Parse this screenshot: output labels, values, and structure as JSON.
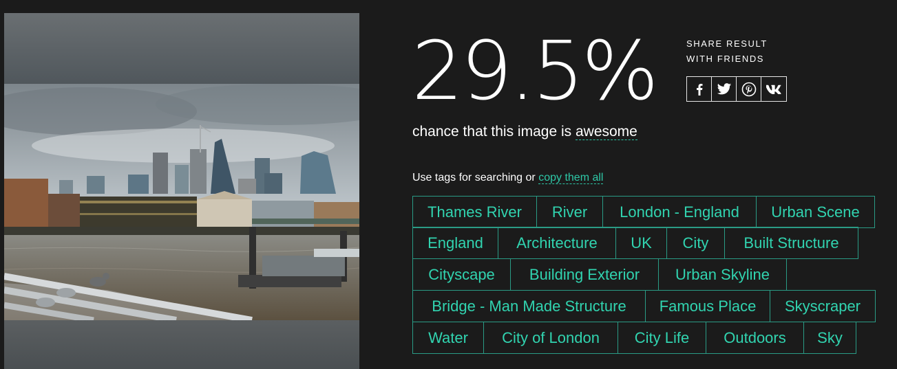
{
  "result": {
    "score": "29.5%",
    "chance_prefix": "chance that this image is",
    "chance_word": "awesome"
  },
  "share": {
    "title_line1": "SHARE RESULT",
    "title_line2": "WITH FRIENDS",
    "buttons": [
      {
        "icon": "facebook-icon"
      },
      {
        "icon": "twitter-icon"
      },
      {
        "icon": "pinterest-icon"
      },
      {
        "icon": "vk-icon"
      }
    ]
  },
  "tags_intro": {
    "text": "Use tags for searching or",
    "copy_link": "copy them all"
  },
  "tags": {
    "rows": [
      [
        "Thames River",
        "River",
        "London - England",
        "Urban Scene"
      ],
      [
        "England",
        "Architecture",
        "UK",
        "City",
        "Built Structure"
      ],
      [
        "Cityscape",
        "Building Exterior",
        "Urban Skyline"
      ],
      [
        "Bridge - Man Made Structure",
        "Famous Place",
        "Skyscraper"
      ],
      [
        "Water",
        "City of London",
        "City Life",
        "Outdoors",
        "Sky"
      ]
    ]
  },
  "colors": {
    "background": "#1b1b1b",
    "accent": "#2ec9a8",
    "tag_border": "#2a9c86"
  }
}
